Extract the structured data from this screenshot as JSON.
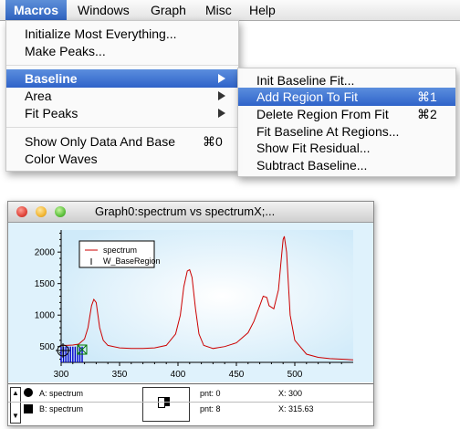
{
  "menubar": {
    "items": [
      "Macros",
      "Windows",
      "Graph",
      "Misc",
      "Help"
    ]
  },
  "macros_menu": {
    "items": [
      {
        "label": "Initialize Most Everything...",
        "shortcut": ""
      },
      {
        "label": "Make Peaks...",
        "shortcut": ""
      },
      {
        "label": "Baseline",
        "shortcut": "",
        "submenu": true,
        "highlighted": true
      },
      {
        "label": "Area",
        "shortcut": "",
        "submenu": true
      },
      {
        "label": "Fit Peaks",
        "shortcut": "",
        "submenu": true
      },
      {
        "label": "Show Only Data And Base",
        "shortcut": "⌘0"
      },
      {
        "label": "Color Waves",
        "shortcut": ""
      }
    ]
  },
  "baseline_submenu": {
    "items": [
      {
        "label": "Init Baseline Fit...",
        "shortcut": ""
      },
      {
        "label": "Add Region To Fit",
        "shortcut": "⌘1",
        "highlighted": true
      },
      {
        "label": "Delete Region From Fit",
        "shortcut": "⌘2"
      },
      {
        "label": "Fit Baseline At Regions...",
        "shortcut": ""
      },
      {
        "label": "Show Fit Residual...",
        "shortcut": ""
      },
      {
        "label": "Subtract Baseline...",
        "shortcut": ""
      }
    ]
  },
  "graph_window": {
    "title": "Graph0:spectrum vs spectrumX;...",
    "legend": [
      "spectrum",
      "W_BaseRegion"
    ]
  },
  "colors": {
    "accent": "#2f63c0",
    "plot_bg": "#d5eefb",
    "trace": "#cc0000",
    "region": "#0000cc"
  },
  "chart_data": {
    "type": "line",
    "xlim": [
      300,
      550
    ],
    "ylim": [
      250,
      2350
    ],
    "xticks": [
      300,
      350,
      400,
      450,
      500
    ],
    "yticks": [
      500,
      1000,
      1500,
      2000
    ],
    "series": [
      {
        "name": "spectrum",
        "x": [
          300,
          305,
          310,
          315,
          320,
          323,
          326,
          328,
          330,
          333,
          336,
          340,
          350,
          360,
          370,
          380,
          390,
          398,
          402,
          405,
          408,
          410,
          412,
          415,
          418,
          422,
          430,
          440,
          450,
          460,
          465,
          470,
          473,
          476,
          478,
          482,
          486,
          488,
          490,
          491,
          493,
          496,
          500,
          510,
          520,
          530,
          540,
          550
        ],
        "y": [
          520,
          520,
          525,
          540,
          620,
          800,
          1150,
          1250,
          1200,
          800,
          600,
          520,
          480,
          470,
          470,
          480,
          520,
          700,
          1000,
          1450,
          1700,
          1720,
          1600,
          1100,
          700,
          520,
          470,
          500,
          560,
          720,
          900,
          1150,
          1300,
          1280,
          1150,
          1100,
          1400,
          1800,
          2200,
          2250,
          2000,
          1000,
          600,
          380,
          330,
          310,
          300,
          290
        ]
      },
      {
        "name": "W_BaseRegion",
        "x": [
          300,
          302,
          304,
          306,
          308,
          310,
          312,
          314,
          316,
          318
        ],
        "y": [
          500,
          500,
          500,
          500,
          500,
          500,
          500,
          500,
          500,
          500
        ]
      }
    ]
  },
  "info_panel": {
    "cursor_a": {
      "label": "A: spectrum",
      "pnt": "pnt: 0",
      "x": "X: 300"
    },
    "cursor_b": {
      "label": "B: spectrum",
      "pnt": "pnt: 8",
      "x": "X: 315.63"
    }
  }
}
